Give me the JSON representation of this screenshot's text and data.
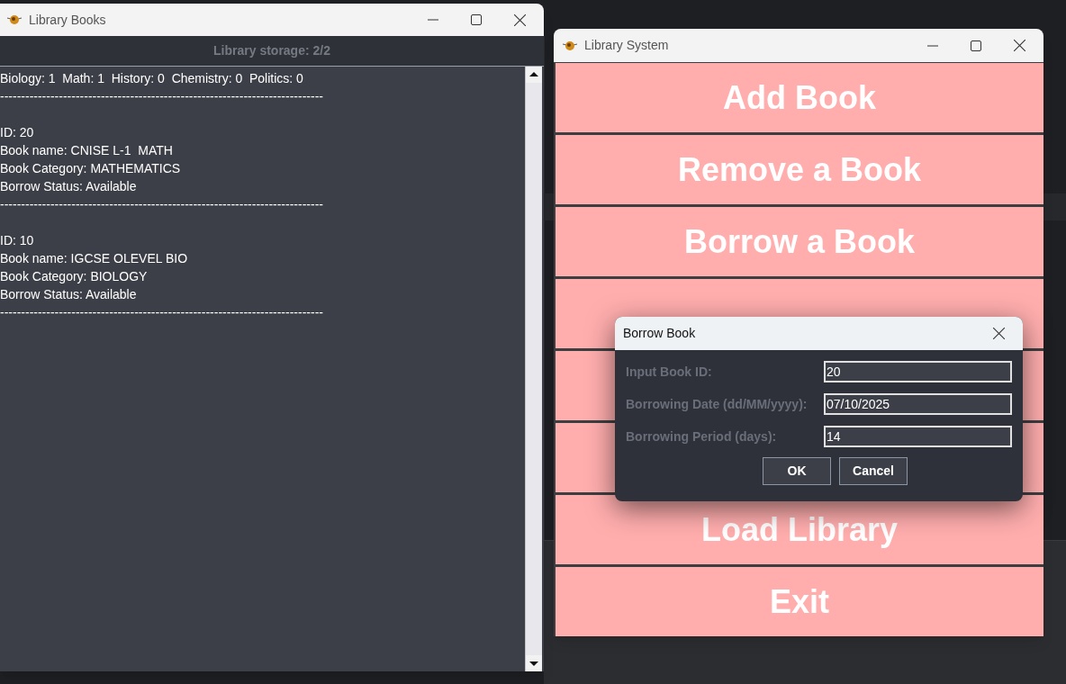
{
  "books_window": {
    "title": "Library Books",
    "storage_label": "Library storage: 2/2",
    "lines": [
      "Biology: 1  Math: 1  History: 0  Chemistry: 0  Politics: 0",
      "-----------------------------------------------------------------------------",
      "ID: 20",
      "Book name: CNISE L-1  MATH",
      "Book Category: MATHEMATICS",
      "Borrow Status: Available",
      "-----------------------------------------------------------------------------",
      "ID: 10",
      "Book name: IGCSE OLEVEL BIO",
      "Book Category: BIOLOGY",
      "Borrow Status: Available",
      "-----------------------------------------------------------------------------"
    ]
  },
  "system_window": {
    "title": "Library System",
    "buttons": [
      {
        "kind": "text",
        "label": "Add Book"
      },
      {
        "kind": "text",
        "label": "Remove a Book"
      },
      {
        "kind": "text",
        "label": "Borrow a Book"
      },
      {
        "kind": "covered"
      },
      {
        "kind": "covered"
      },
      {
        "kind": "covered"
      },
      {
        "kind": "text",
        "label": "Load Library"
      },
      {
        "kind": "text",
        "label": "Exit"
      }
    ]
  },
  "dialog": {
    "title": "Borrow Book",
    "fields": [
      {
        "label": "Input Book ID:",
        "value": "20"
      },
      {
        "label": "Borrowing Date (dd/MM/yyyy):",
        "value": "07/10/2025"
      },
      {
        "label": "Borrowing Period (days):",
        "value": "14"
      }
    ],
    "buttons": [
      "OK",
      "Cancel"
    ]
  }
}
